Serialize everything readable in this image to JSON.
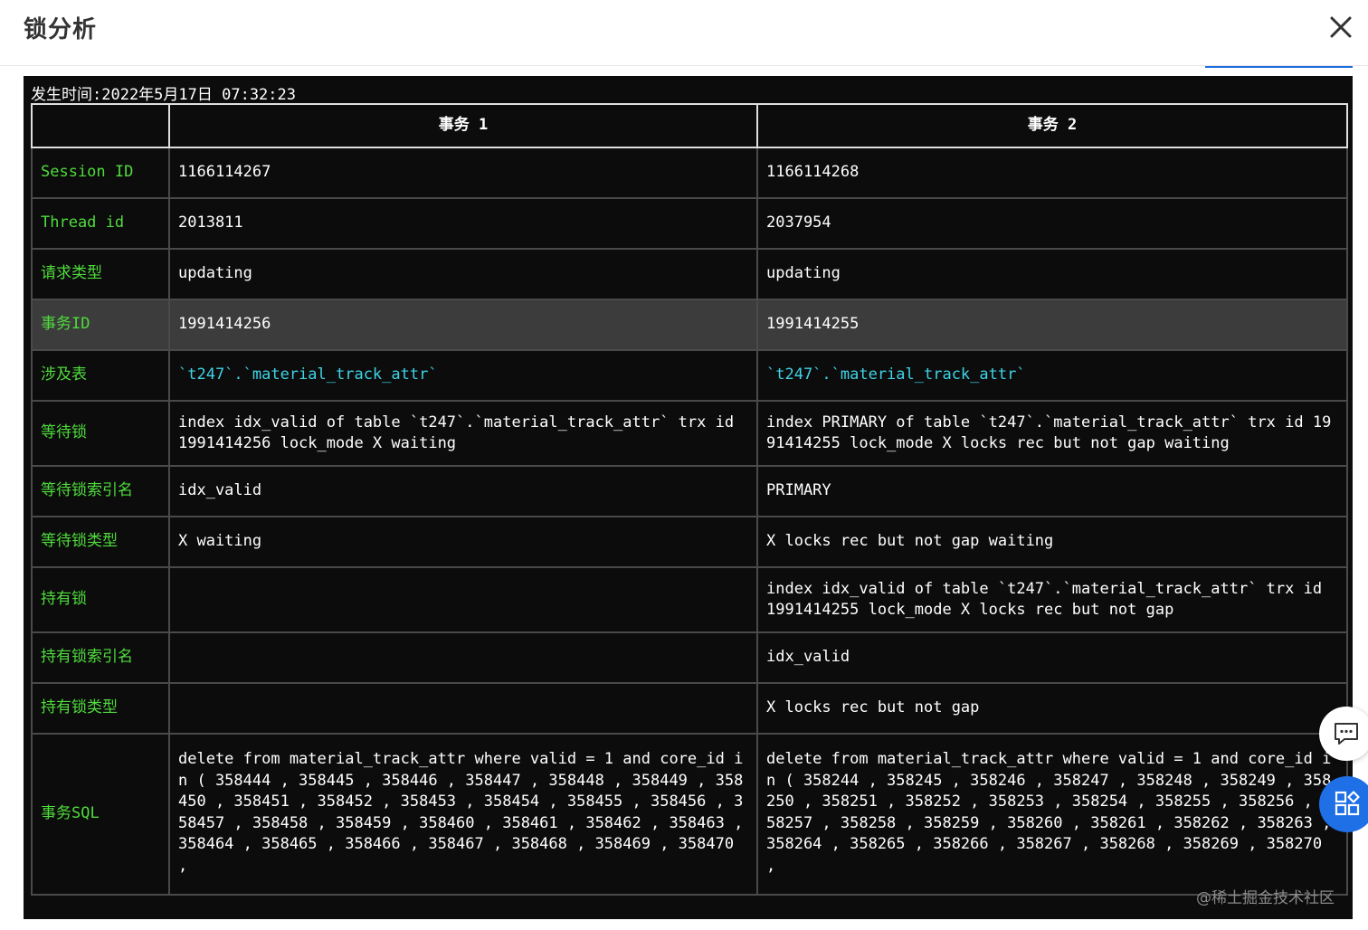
{
  "dialog": {
    "title": "锁分析",
    "close_icon": "close-icon"
  },
  "panel": {
    "occurred_time": "发生时间:2022年5月17日 07:32:23",
    "headers": [
      "",
      "事务 1",
      "事务 2"
    ],
    "rows": [
      {
        "label": "Session ID",
        "t1": "1166114267",
        "t2": "1166114268"
      },
      {
        "label": "Thread id",
        "t1": "2013811",
        "t2": "2037954"
      },
      {
        "label": "请求类型",
        "t1": "updating",
        "t2": "updating"
      },
      {
        "label": "事务ID",
        "t1": "1991414256",
        "t2": "1991414255",
        "highlighted": true
      },
      {
        "label": "涉及表",
        "t1": "`t247`.`material_track_attr`",
        "t2": "`t247`.`material_track_attr`"
      },
      {
        "label": "等待锁",
        "t1": "index idx_valid of table `t247`.`material_track_attr` trx id 1991414256 lock_mode X waiting",
        "t2": "index PRIMARY of table `t247`.`material_track_attr` trx id 1991414255 lock_mode X locks rec but not gap waiting"
      },
      {
        "label": "等待锁索引名",
        "t1": "idx_valid",
        "t2": "PRIMARY"
      },
      {
        "label": "等待锁类型",
        "t1": "X waiting",
        "t2": "X locks rec but not gap waiting"
      },
      {
        "label": "持有锁",
        "t1": "",
        "t2": "index idx_valid of table `t247`.`material_track_attr` trx id 1991414255 lock_mode X locks rec but not gap"
      },
      {
        "label": "持有锁索引名",
        "t1": "",
        "t2": "idx_valid"
      },
      {
        "label": "持有锁类型",
        "t1": "",
        "t2": "X locks rec but not gap"
      },
      {
        "label": "事务SQL",
        "t1": "delete from material_track_attr where valid = 1 and core_id in ( 358444 , 358445 , 358446 , 358447 , 358448 , 358449 , 358450 , 358451 , 358452 , 358453 , 358454 , 358455 , 358456 , 358457 , 358458 , 358459 , 358460 , 358461 , 358462 , 358463 , 358464 , 358465 , 358466 , 358467 , 358468 , 358469 , 358470 ,",
        "t2": "delete from material_track_attr where valid = 1 and core_id in ( 358244 , 358245 , 358246 , 358247 , 358248 , 358249 , 358250 , 358251 , 358252 , 358253 , 358254 , 358255 , 358256 , 358257 , 358258 , 358259 , 358260 , 358261 , 358262 , 358263 , 358264 , 358265 , 358266 , 358267 , 358268 , 358269 , 358270 ,"
      }
    ]
  },
  "floating": {
    "chat_icon": "chat-bubble-icon",
    "apps_icon": "apps-grid-icon"
  },
  "watermark": "@稀土掘金技术社区",
  "colors": {
    "panel_bg": "#0c0c0c",
    "label_green": "#4fdc3c",
    "table_cyan": "#3fd3e6",
    "highlight_row": "#3c3c3c",
    "fab_blue": "#1f6fe6"
  }
}
